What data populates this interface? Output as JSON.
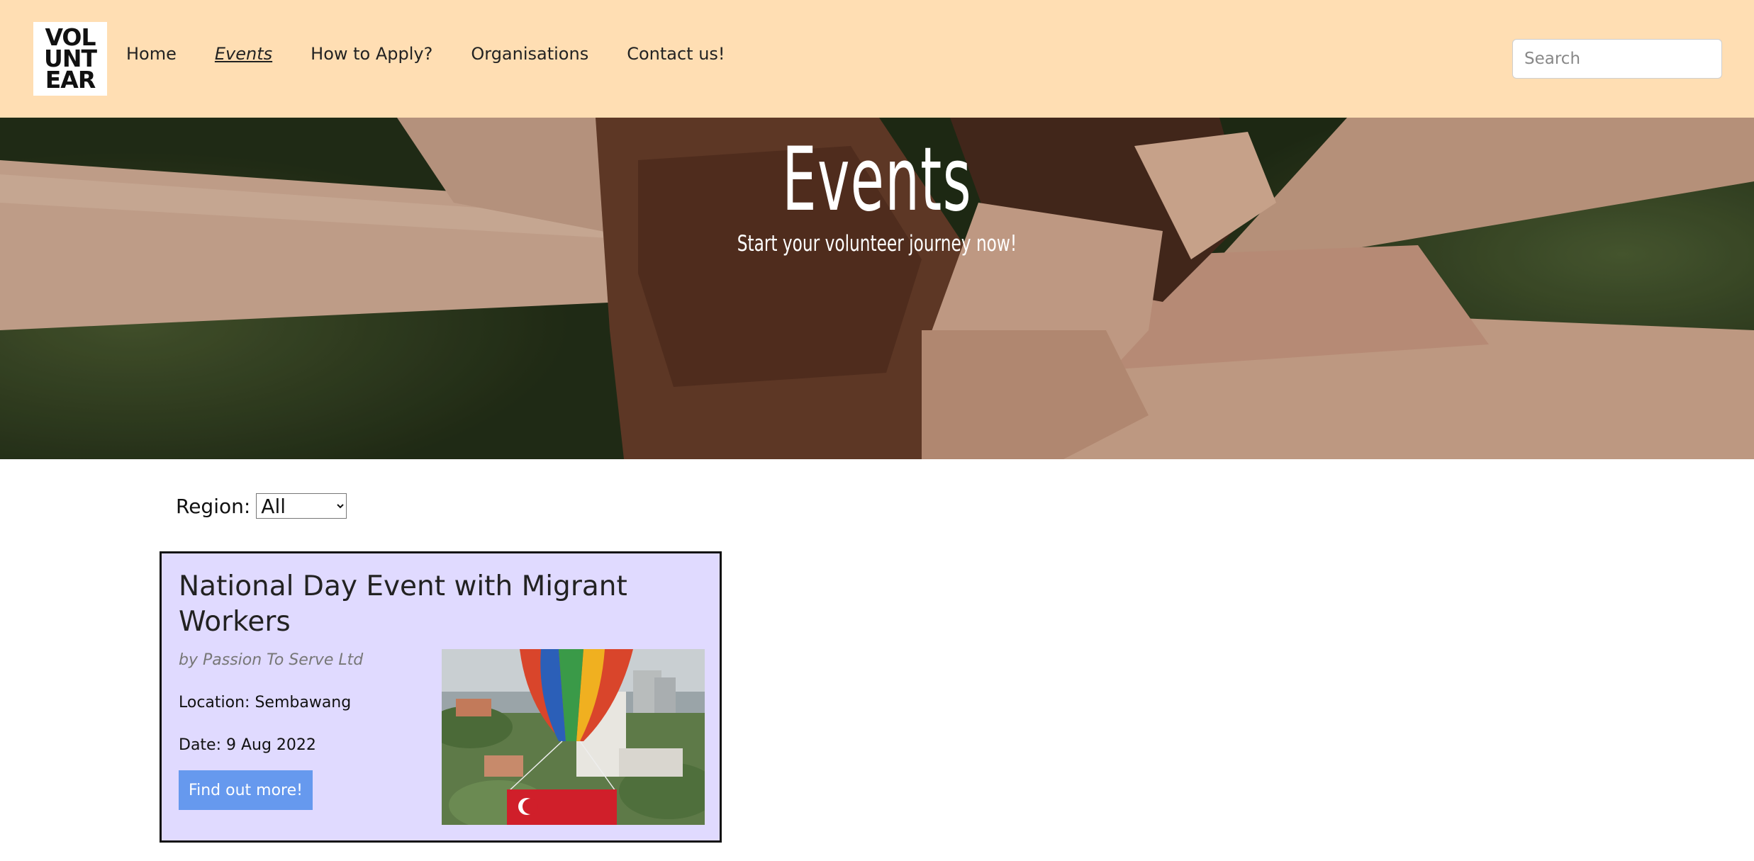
{
  "nav": {
    "logo_lines": [
      "VOL",
      "UNT",
      "EAR"
    ],
    "links": [
      {
        "label": "Home",
        "active": false
      },
      {
        "label": "Events",
        "active": true
      },
      {
        "label": "How to Apply?",
        "active": false
      },
      {
        "label": "Organisations",
        "active": false
      },
      {
        "label": "Contact us!",
        "active": false
      }
    ],
    "search": {
      "placeholder": "Search",
      "value": ""
    }
  },
  "hero": {
    "title": "Events",
    "subtitle": "Start your volunteer journey now!"
  },
  "filter": {
    "label": "Region:",
    "selected": "All"
  },
  "events": [
    {
      "title": "National Day Event with Migrant Workers",
      "organiser": "by Passion To Serve Ltd",
      "location": "Location: Sembawang",
      "date": "Date: 9 Aug 2022",
      "button_label": "Find out more!"
    }
  ],
  "colors": {
    "navbar_bg": "#ffdeb3",
    "card_bg": "#e0daff",
    "button_bg": "#6699ee"
  }
}
